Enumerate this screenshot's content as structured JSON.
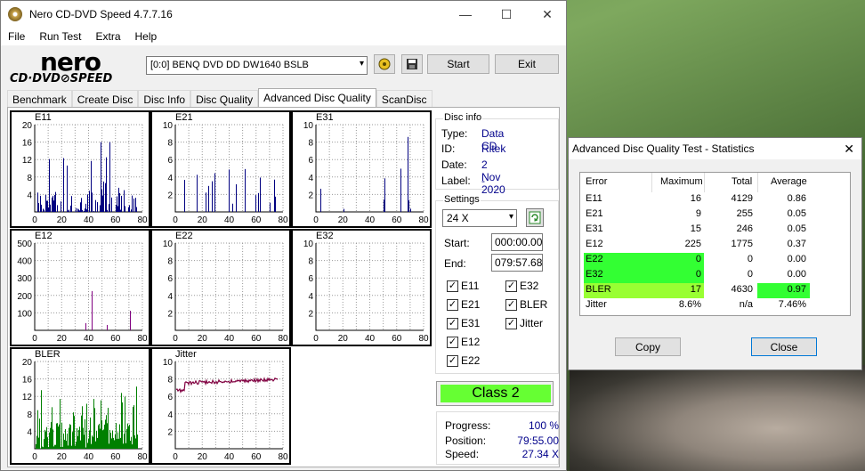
{
  "main_window": {
    "title": "Nero CD-DVD Speed 4.7.7.16",
    "controls": {
      "minimize": "—",
      "maximize": "☐",
      "close": "✕"
    }
  },
  "menu": [
    "File",
    "Run Test",
    "Extra",
    "Help"
  ],
  "logo": {
    "line1": "nero",
    "line2": "CD·DVD⊘SPEED"
  },
  "drive": {
    "selected": "[0:0]   BENQ DVD DD DW1640 BSLB"
  },
  "toolbar": {
    "start": "Start",
    "exit": "Exit",
    "drive_icon": "drive-settings-icon",
    "save_icon": "floppy-save-icon"
  },
  "tabs": [
    "Benchmark",
    "Create Disc",
    "Disc Info",
    "Disc Quality",
    "Advanced Disc Quality",
    "ScanDisc"
  ],
  "active_tab": "Advanced Disc Quality",
  "disc_info": {
    "title": "Disc info",
    "type_label": "Type:",
    "type": "Data CD",
    "id_label": "ID:",
    "id": "Ritek",
    "date_label": "Date:",
    "date": "2 Nov 2020",
    "label_label": "Label:",
    "label": "-"
  },
  "settings": {
    "title": "Settings",
    "speed": "24 X",
    "start_label": "Start:",
    "start": "000:00.00",
    "end_label": "End:",
    "end": "079:57.68",
    "checks": [
      {
        "name": "E11",
        "checked": true
      },
      {
        "name": "E32",
        "checked": true
      },
      {
        "name": "E21",
        "checked": true
      },
      {
        "name": "BLER",
        "checked": true
      },
      {
        "name": "E31",
        "checked": true
      },
      {
        "name": "Jitter",
        "checked": true
      },
      {
        "name": "E12",
        "checked": true
      },
      {
        "name": "E22",
        "checked": true
      }
    ]
  },
  "class": "Class 2",
  "progress": {
    "progress_label": "Progress:",
    "progress": "100 %",
    "position_label": "Position:",
    "position": "79:55.00",
    "speed_label": "Speed:",
    "speed": "27.34 X"
  },
  "chart_data": [
    {
      "type": "bar",
      "title": "E11",
      "x_ticks": [
        "0",
        "20",
        "40",
        "60",
        "80"
      ],
      "y_ticks": [
        "20",
        "16",
        "12",
        "8",
        "4"
      ],
      "ylim": [
        0,
        20
      ],
      "xlim": [
        0,
        80
      ],
      "color": "#000080",
      "note_peak": 16
    },
    {
      "type": "bar",
      "title": "E21",
      "x_ticks": [
        "0",
        "20",
        "40",
        "60",
        "80"
      ],
      "y_ticks": [
        "10",
        "8",
        "6",
        "4",
        "2"
      ],
      "ylim": [
        0,
        10
      ],
      "xlim": [
        0,
        80
      ],
      "color": "#000080",
      "note_peak": 9
    },
    {
      "type": "bar",
      "title": "E31",
      "x_ticks": [
        "0",
        "20",
        "40",
        "60",
        "80"
      ],
      "y_ticks": [
        "10",
        "8",
        "6",
        "4",
        "2"
      ],
      "ylim": [
        0,
        10
      ],
      "xlim": [
        0,
        80
      ],
      "color": "#000080",
      "note_peak": 15
    },
    {
      "type": "bar",
      "title": "E12",
      "x_ticks": [
        "0",
        "20",
        "40",
        "60",
        "80"
      ],
      "y_ticks": [
        "500",
        "400",
        "300",
        "200",
        "100"
      ],
      "ylim": [
        0,
        500
      ],
      "xlim": [
        0,
        80
      ],
      "color": "#800080",
      "note_peak": 225
    },
    {
      "type": "bar",
      "title": "E22",
      "x_ticks": [
        "0",
        "20",
        "40",
        "60",
        "80"
      ],
      "y_ticks": [
        "10",
        "8",
        "6",
        "4",
        "2"
      ],
      "ylim": [
        0,
        10
      ],
      "xlim": [
        0,
        80
      ],
      "color": "#000080",
      "note_peak": 0
    },
    {
      "type": "bar",
      "title": "E32",
      "x_ticks": [
        "0",
        "20",
        "40",
        "60",
        "80"
      ],
      "y_ticks": [
        "10",
        "8",
        "6",
        "4",
        "2"
      ],
      "ylim": [
        0,
        10
      ],
      "xlim": [
        0,
        80
      ],
      "color": "#000080",
      "note_peak": 0
    },
    {
      "type": "bar",
      "title": "BLER",
      "x_ticks": [
        "0",
        "20",
        "40",
        "60",
        "80"
      ],
      "y_ticks": [
        "20",
        "16",
        "12",
        "8",
        "4"
      ],
      "ylim": [
        0,
        20
      ],
      "xlim": [
        0,
        80
      ],
      "color": "#008000",
      "note_peak": 17
    },
    {
      "type": "line",
      "title": "Jitter",
      "x_ticks": [
        "0",
        "20",
        "40",
        "60",
        "80"
      ],
      "y_ticks": [
        "10",
        "8",
        "6",
        "4",
        "2"
      ],
      "ylim": [
        0,
        10
      ],
      "xlim": [
        0,
        80
      ],
      "color": "#800040"
    }
  ],
  "stats": {
    "title": "Advanced Disc Quality Test - Statistics",
    "close": "✕",
    "headers": [
      "Error",
      "Maximum",
      "Total",
      "Average"
    ],
    "rows": [
      {
        "error": "E11",
        "maximum": "16",
        "total": "4129",
        "average": "0.86",
        "hl_err": "",
        "hl_max": "",
        "hl_avg": ""
      },
      {
        "error": "E21",
        "maximum": "9",
        "total": "255",
        "average": "0.05",
        "hl_err": "",
        "hl_max": "",
        "hl_avg": ""
      },
      {
        "error": "E31",
        "maximum": "15",
        "total": "246",
        "average": "0.05",
        "hl_err": "",
        "hl_max": "",
        "hl_avg": ""
      },
      {
        "error": "E12",
        "maximum": "225",
        "total": "1775",
        "average": "0.37",
        "hl_err": "",
        "hl_max": "",
        "hl_avg": ""
      },
      {
        "error": "E22",
        "maximum": "0",
        "total": "0",
        "average": "0.00",
        "hl_err": "#33ff33",
        "hl_max": "#33ff33",
        "hl_avg": ""
      },
      {
        "error": "E32",
        "maximum": "0",
        "total": "0",
        "average": "0.00",
        "hl_err": "#33ff33",
        "hl_max": "#33ff33",
        "hl_avg": ""
      },
      {
        "error": "BLER",
        "maximum": "17",
        "total": "4630",
        "average": "0.97",
        "hl_err": "#99ff33",
        "hl_max": "#99ff33",
        "hl_avg": "#33ff33"
      },
      {
        "error": "Jitter",
        "maximum": "8.6%",
        "total": "n/a",
        "average": "7.46%",
        "hl_err": "",
        "hl_max": "",
        "hl_avg": ""
      }
    ],
    "copy": "Copy",
    "close_button": "Close"
  }
}
